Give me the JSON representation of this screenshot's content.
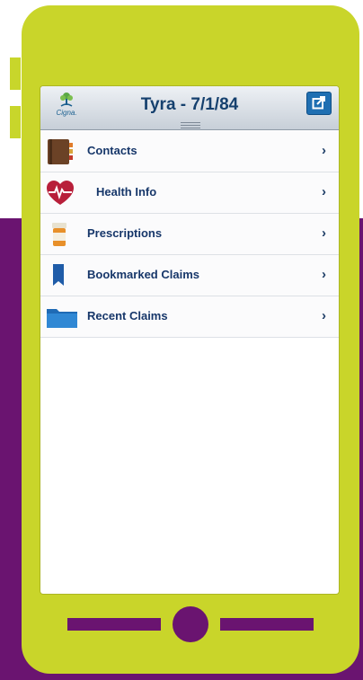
{
  "header": {
    "logo_text": "Cigna.",
    "title": "Tyra - 7/1/84",
    "share_icon": "share-icon"
  },
  "menu": {
    "items": [
      {
        "label": "Contacts",
        "icon": "address-book-icon"
      },
      {
        "label": "Health Info",
        "icon": "heart-pulse-icon"
      },
      {
        "label": "Prescriptions",
        "icon": "pill-bottle-icon"
      },
      {
        "label": "Bookmarked Claims",
        "icon": "bookmark-icon"
      },
      {
        "label": "Recent Claims",
        "icon": "folder-icon"
      }
    ],
    "chevron": "›"
  },
  "colors": {
    "phone_body": "#c9d52a",
    "purple": "#6a1470",
    "header_text": "#15406e",
    "share_button": "#1f6fb2"
  }
}
